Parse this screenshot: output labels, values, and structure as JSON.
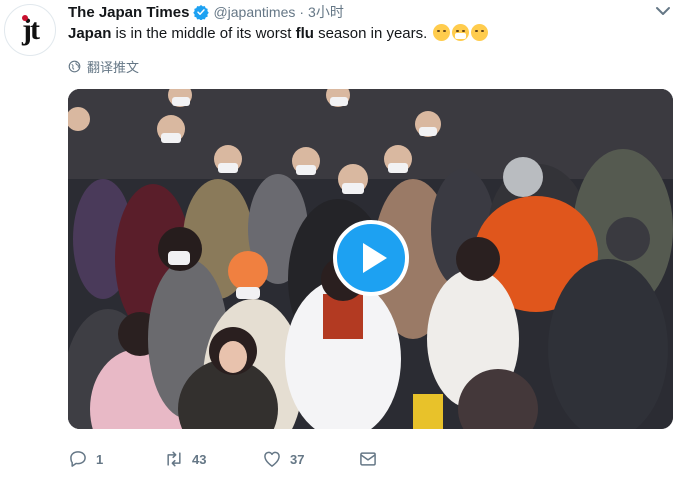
{
  "author": {
    "avatar_text": "jt",
    "name": "The Japan Times",
    "handle": "@japantimes",
    "separator": "·",
    "time": "3小时"
  },
  "tweet": {
    "word1": "Japan",
    "part2": " is in the middle of its worst ",
    "word2": "flu",
    "part3": " season in years. ",
    "emojis": [
      "sneezing-face-emoji",
      "medical-mask-face-emoji",
      "thermometer-face-emoji"
    ]
  },
  "translate_label": "翻译推文",
  "media": {
    "type": "video",
    "description_icon": "play-icon"
  },
  "actions": {
    "reply_count": "1",
    "retweet_count": "43",
    "like_count": "37"
  },
  "colors": {
    "accent": "#1da1f2",
    "text": "#14171a",
    "secondary": "#657786"
  }
}
